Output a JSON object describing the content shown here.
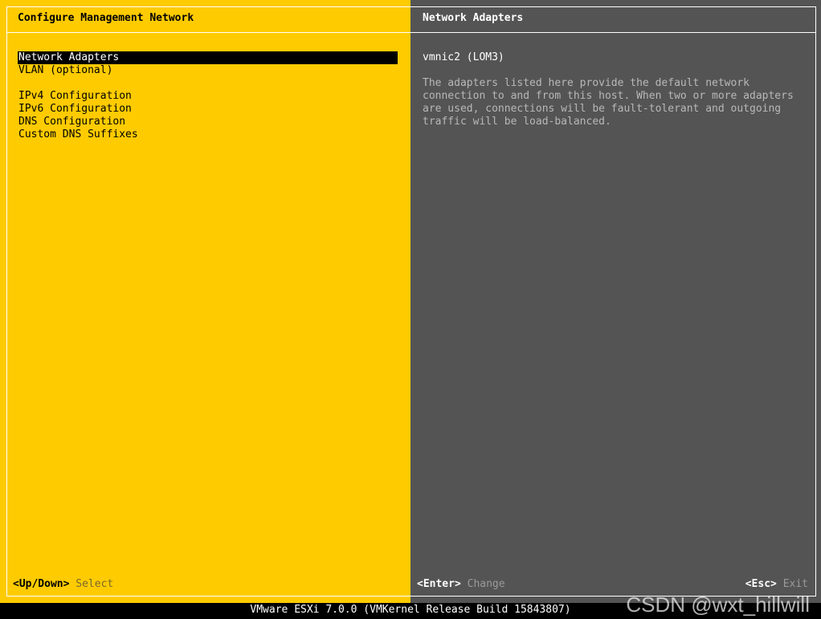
{
  "left_panel": {
    "title": "Configure Management Network",
    "menu": [
      "Network Adapters",
      "VLAN (optional)",
      "IPv4 Configuration",
      "IPv6 Configuration",
      "DNS Configuration",
      "Custom DNS Suffixes"
    ],
    "selected_index": 0,
    "hint_key": "<Up/Down>",
    "hint_action": "Select"
  },
  "right_panel": {
    "title": "Network Adapters",
    "adapter": "vmnic2 (LOM3)",
    "description": "The adapters listed here provide the default network\nconnection to and from this host. When two or more adapters\nare used, connections will be fault-tolerant and outgoing\ntraffic will be load-balanced.",
    "enter_key": "<Enter>",
    "enter_action": "Change",
    "esc_key": "<Esc>",
    "esc_action": "Exit"
  },
  "status_bar": "VMware ESXi 7.0.0 (VMKernel Release Build 15843807)",
  "watermark": "CSDN @wxt_hillwill",
  "colors": {
    "left_background": "#fecb00",
    "right_background": "#545454",
    "selection_background": "#000000"
  }
}
